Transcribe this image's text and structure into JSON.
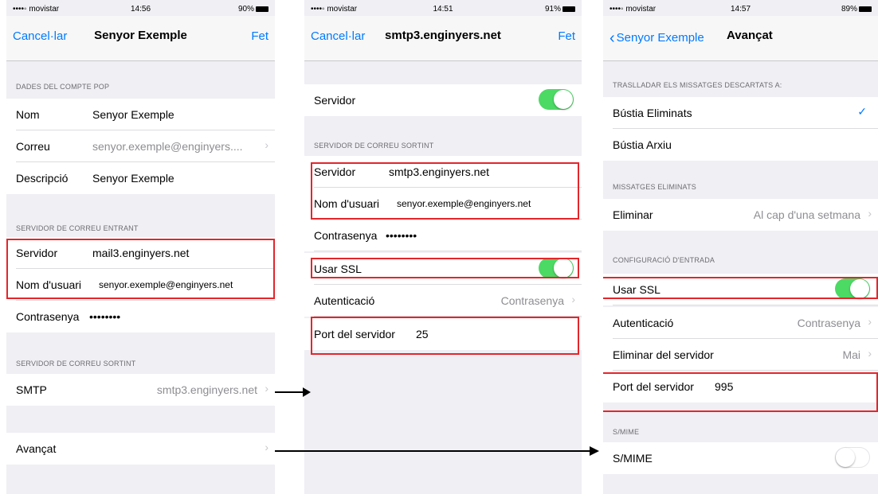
{
  "status": {
    "carrier": "••••◦ movistar",
    "wifi": "wifi-icon",
    "battery_icon": "battery-icon",
    "times": [
      "14:56",
      "14:51",
      "14:57"
    ],
    "battery": [
      "90%",
      "91%",
      "89%"
    ]
  },
  "screen1": {
    "cancel": "Cancel·lar",
    "title": "Senyor Exemple",
    "done": "Fet",
    "sec_account": "DADES DEL COMPTE POP",
    "nom_label": "Nom",
    "nom_value": "Senyor Exemple",
    "correu_label": "Correu",
    "correu_value": "senyor.exemple@enginyers....",
    "desc_label": "Descripció",
    "desc_value": "Senyor Exemple",
    "sec_incoming": "SERVIDOR DE CORREU ENTRANT",
    "server_label": "Servidor",
    "server_value": "mail3.enginyers.net",
    "user_label": "Nom d'usuari",
    "user_value": "senyor.exemple@enginyers.net",
    "pass_label": "Contrasenya",
    "pass_value": "••••••••",
    "sec_outgoing": "SERVIDOR DE CORREU SORTINT",
    "smtp_label": "SMTP",
    "smtp_value": "smtp3.enginyers.net",
    "advanced_label": "Avançat"
  },
  "screen2": {
    "cancel": "Cancel·lar",
    "title": "smtp3.enginyers.net",
    "done": "Fet",
    "server_toggle_label": "Servidor",
    "server_toggle_on": true,
    "sec_outgoing": "SERVIDOR DE CORREU SORTINT",
    "host_label": "Servidor",
    "host_value": "smtp3.enginyers.net",
    "user_label": "Nom d'usuari",
    "user_value": "senyor.exemple@enginyers.net",
    "pass_label": "Contrasenya",
    "pass_value": "••••••••",
    "ssl_label": "Usar SSL",
    "ssl_on": true,
    "auth_label": "Autenticació",
    "auth_value": "Contrasenya",
    "port_label": "Port del servidor",
    "port_value": "25"
  },
  "screen3": {
    "back": "Senyor Exemple",
    "title": "Avançat",
    "sec_move": "TRASLLADAR ELS MISSATGES DESCARTATS A:",
    "mailbox_deleted": "Bústia Eliminats",
    "mailbox_archive": "Bústia Arxiu",
    "sec_deleted": "MISSATGES ELIMINATS",
    "remove_label": "Eliminar",
    "remove_value": "Al cap d'una setmana",
    "sec_incoming": "CONFIGURACIÓ D'ENTRADA",
    "ssl_label": "Usar SSL",
    "ssl_on": true,
    "auth_label": "Autenticació",
    "auth_value": "Contrasenya",
    "del_server_label": "Eliminar del servidor",
    "del_server_value": "Mai",
    "port_label": "Port del servidor",
    "port_value": "995",
    "sec_smime": "S/MIME",
    "smime_label": "S/MIME",
    "smime_on": false
  },
  "colors": {
    "accent": "#007aff",
    "toggle_on": "#4cd964",
    "highlight": "#e3262b",
    "background": "#efeff4"
  }
}
